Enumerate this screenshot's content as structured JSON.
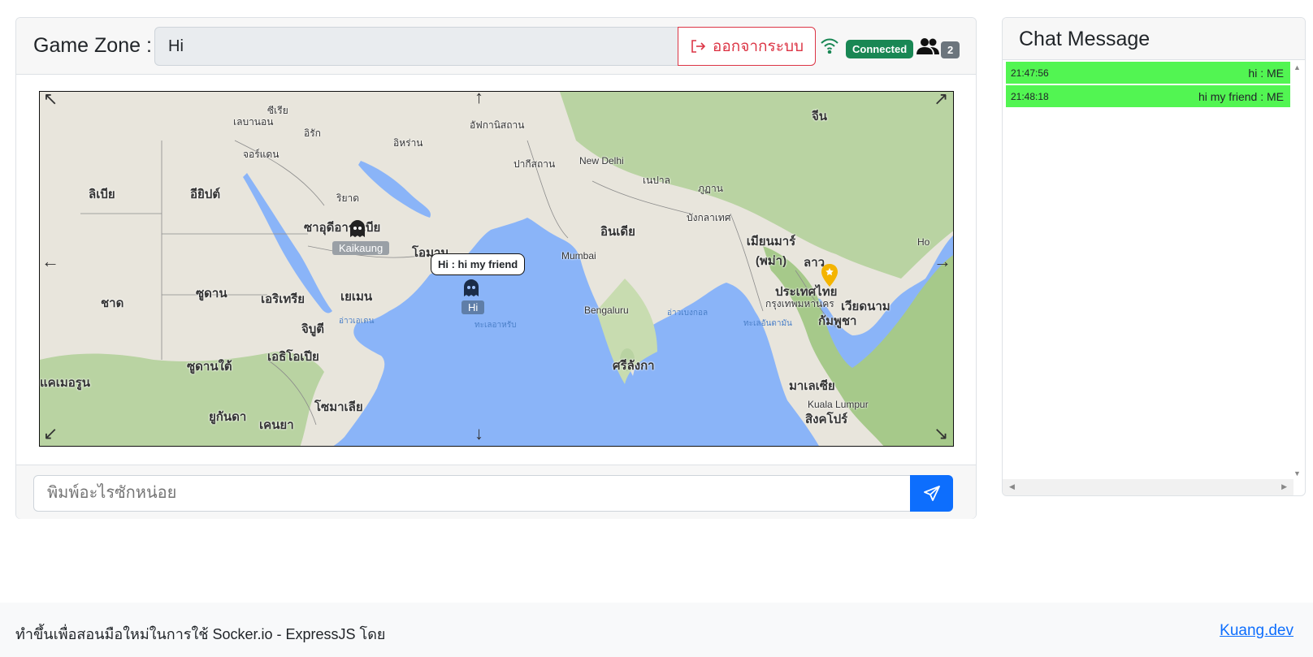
{
  "header": {
    "zone_label": "Game Zone :",
    "player_name": "Hi",
    "logout_label": "ออกจากระบบ",
    "status_label": "Connected",
    "user_count": "2"
  },
  "map": {
    "players": [
      {
        "name": "Kaikaung",
        "self": false
      },
      {
        "name": "Hi",
        "self": true,
        "bubble": "Hi : hi my friend"
      }
    ],
    "labels": {
      "syria": "ซีเรีย",
      "lebanon": "เลบานอน",
      "iraq": "อิรัก",
      "iran": "อิหร่าน",
      "afghanistan": "อัฟกานิสถาน",
      "pakistan": "ปากีสถาน",
      "china": "จีน",
      "libya": "ลิเบีย",
      "egypt": "อียิปต์",
      "saudi": "ซาอุดีอาระเบีย",
      "oman": "โอมาน",
      "yemen": "เยเมน",
      "sudan": "ซูดาน",
      "chad": "ชาด",
      "eritrea": "เอริเทรีย",
      "djibouti": "จิบูตี",
      "ethiopia": "เอธิโอเปีย",
      "south_sudan": "ซูดานใต้",
      "somalia": "โซมาเลีย",
      "kenya": "เคนยา",
      "uganda": "ยูกันดา",
      "cameroon": "แคเมอรูน",
      "india": "อินเดีย",
      "nepal": "เนปาล",
      "bhutan": "ภูฏาน",
      "bangladesh": "บังกลาเทศ",
      "myanmar": "เมียนมาร์ (พม่า)",
      "laos": "ลาว",
      "thailand": "ประเทศไทย",
      "vietnam": "เวียดนาม",
      "cambodia": "กัมพูชา",
      "sri_lanka": "ศรีลังกา",
      "malaysia": "มาเลเซีย",
      "singapore": "สิงคโปร์",
      "kuala": "Kuala Lumpur",
      "new_delhi": "New Delhi",
      "mumbai": "Mumbai",
      "bengaluru": "Bengaluru",
      "riyadh": "ริยาด",
      "jordan": "จอร์แดน",
      "bangkok": "กรุงเทพมหานคร",
      "arabian_sea": "ทะเลอาหรับ",
      "bay_of_bengal": "อ่าวเบงกอล",
      "andaman": "ทะเลอันดามัน",
      "gulf_aden": "อ่าวเอเดน",
      "hong": "Ho"
    }
  },
  "composer": {
    "placeholder": "พิมพ์อะไรซักหน่อย"
  },
  "chat": {
    "title": "Chat Message",
    "messages": [
      {
        "time": "21:47:56",
        "text": "hi : ME"
      },
      {
        "time": "21:48:18",
        "text": "hi my friend : ME"
      }
    ]
  },
  "footer": {
    "text": "ทำขึ้นเพื่อสอนมือใหม่ในการใช้ Socker.io - ExpressJS โดย",
    "link": "Kuang.dev"
  },
  "colors": {
    "connected": "#198754",
    "danger": "#dc3545",
    "primary": "#0d6efd",
    "chat_bubble": "#52f552",
    "sea": "#8ab4f8"
  }
}
